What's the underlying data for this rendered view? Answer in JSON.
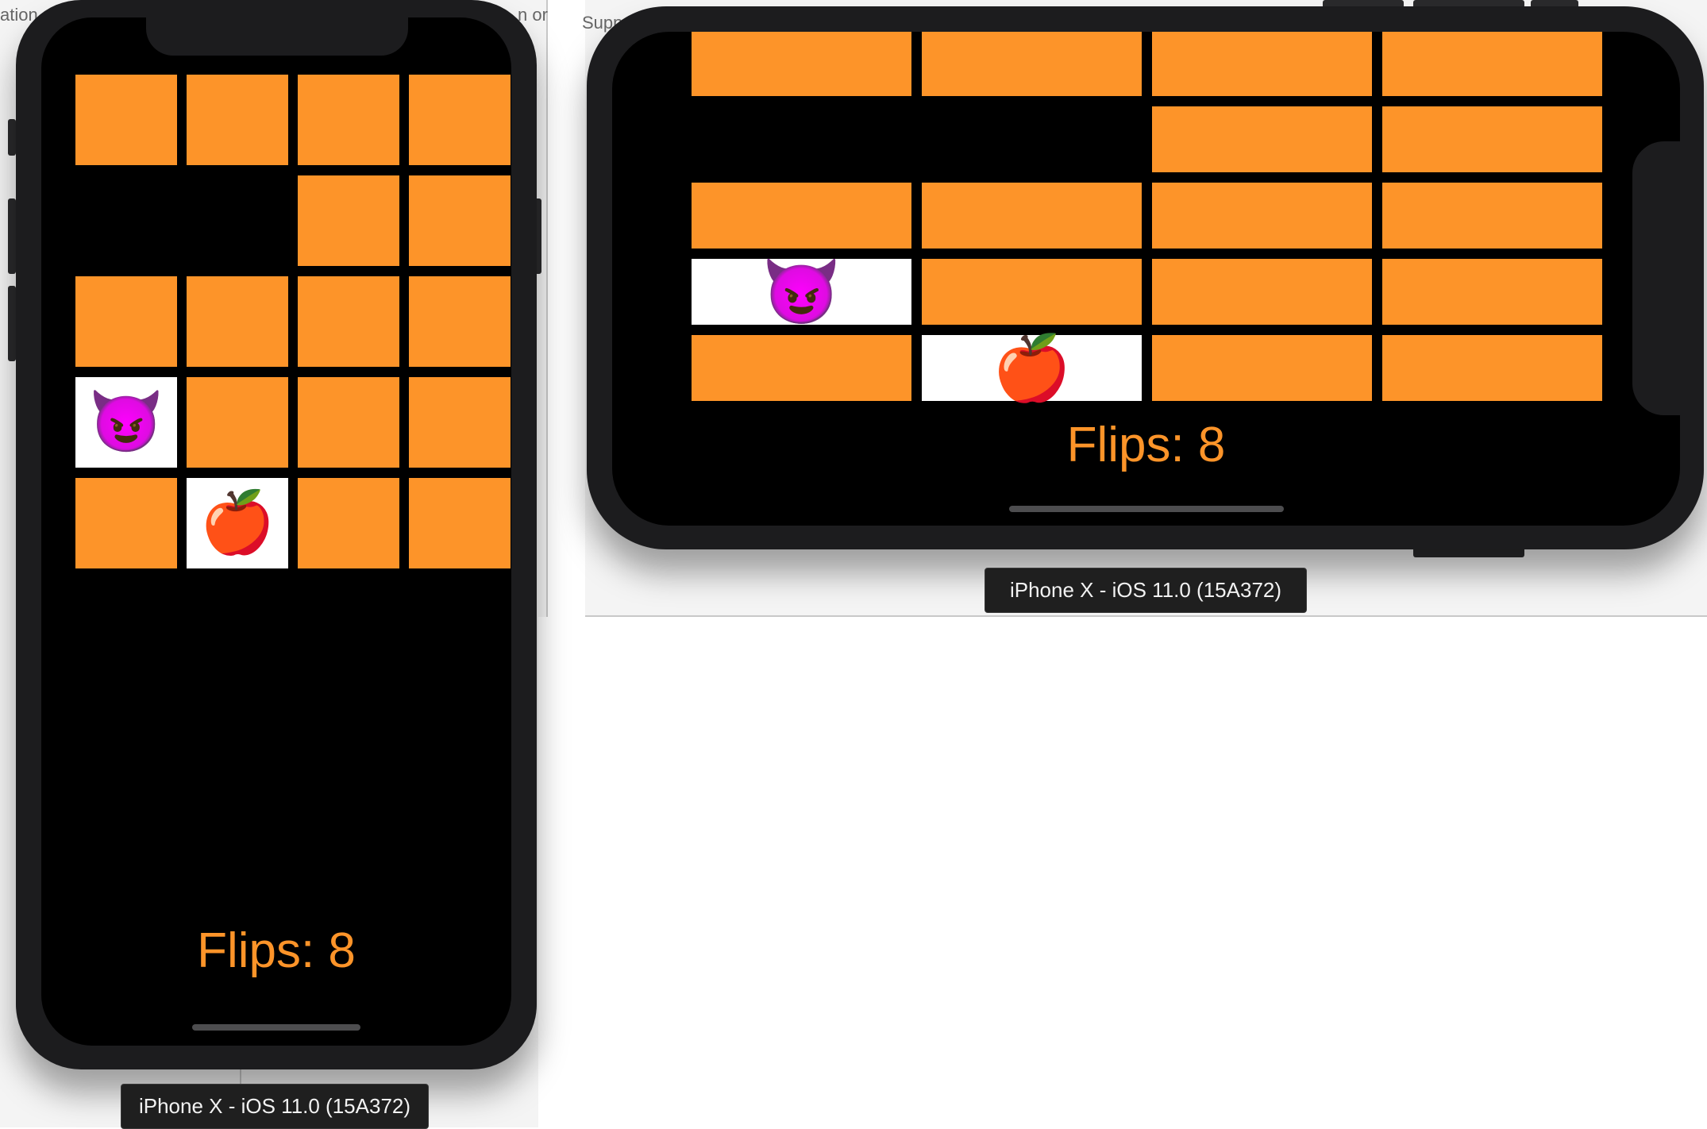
{
  "background_fragments": {
    "left_top": "ation",
    "left_top_right": "n or",
    "right_top": "Supp"
  },
  "portrait": {
    "flips_label": "Flips: 8",
    "device_label": "iPhone X - iOS 11.0 (15A372)",
    "cards": [
      {
        "state": "face-down"
      },
      {
        "state": "face-down"
      },
      {
        "state": "face-down"
      },
      {
        "state": "face-down"
      },
      {
        "state": "matched"
      },
      {
        "state": "matched"
      },
      {
        "state": "face-down"
      },
      {
        "state": "face-down"
      },
      {
        "state": "face-down"
      },
      {
        "state": "face-down"
      },
      {
        "state": "face-down"
      },
      {
        "state": "face-down"
      },
      {
        "state": "face-up",
        "emoji": "😈"
      },
      {
        "state": "face-down"
      },
      {
        "state": "face-down"
      },
      {
        "state": "face-down"
      },
      {
        "state": "face-down"
      },
      {
        "state": "face-up",
        "emoji": "🍎"
      },
      {
        "state": "face-down"
      },
      {
        "state": "face-down"
      }
    ]
  },
  "landscape": {
    "flips_label": "Flips: 8",
    "device_label": "iPhone X - iOS 11.0 (15A372)",
    "cards": [
      {
        "state": "face-down"
      },
      {
        "state": "face-down"
      },
      {
        "state": "face-down"
      },
      {
        "state": "face-down"
      },
      {
        "state": "matched"
      },
      {
        "state": "matched"
      },
      {
        "state": "face-down"
      },
      {
        "state": "face-down"
      },
      {
        "state": "face-down"
      },
      {
        "state": "face-down"
      },
      {
        "state": "face-down"
      },
      {
        "state": "face-down"
      },
      {
        "state": "face-up",
        "emoji": "😈"
      },
      {
        "state": "face-down"
      },
      {
        "state": "face-down"
      },
      {
        "state": "face-down"
      },
      {
        "state": "face-down"
      },
      {
        "state": "face-up",
        "emoji": "🍎"
      },
      {
        "state": "face-down"
      },
      {
        "state": "face-down"
      }
    ]
  },
  "colors": {
    "card_back": "#fd9429",
    "card_face": "#ffffff",
    "screen_bg": "#000000",
    "flips_text": "#fd9429"
  }
}
